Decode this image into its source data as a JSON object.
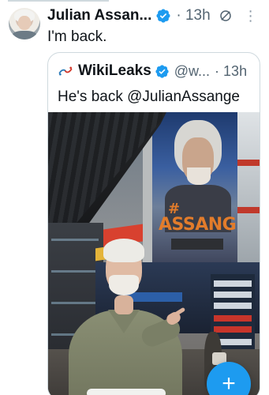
{
  "tweet": {
    "author_name": "Julian Assan...",
    "time": "· 13h",
    "text": "I'm back.",
    "icons": [
      "avatar",
      "verified-badge-icon",
      "grok-icon",
      "more-icon"
    ]
  },
  "quoted_tweet": {
    "author_name": "WikiLeaks",
    "handle": "@w...",
    "time": "· 13h",
    "text": "He's back @JulianAssange",
    "photo": {
      "mural_text_hash": "#",
      "mural_text_word": "ASSANGE"
    }
  },
  "compose": {
    "icon": "plus-icon",
    "symbol": "+"
  },
  "colors": {
    "accent": "#1d9bf0",
    "text": "#0f1419",
    "secondary": "#536471",
    "border": "#cfd9de"
  }
}
